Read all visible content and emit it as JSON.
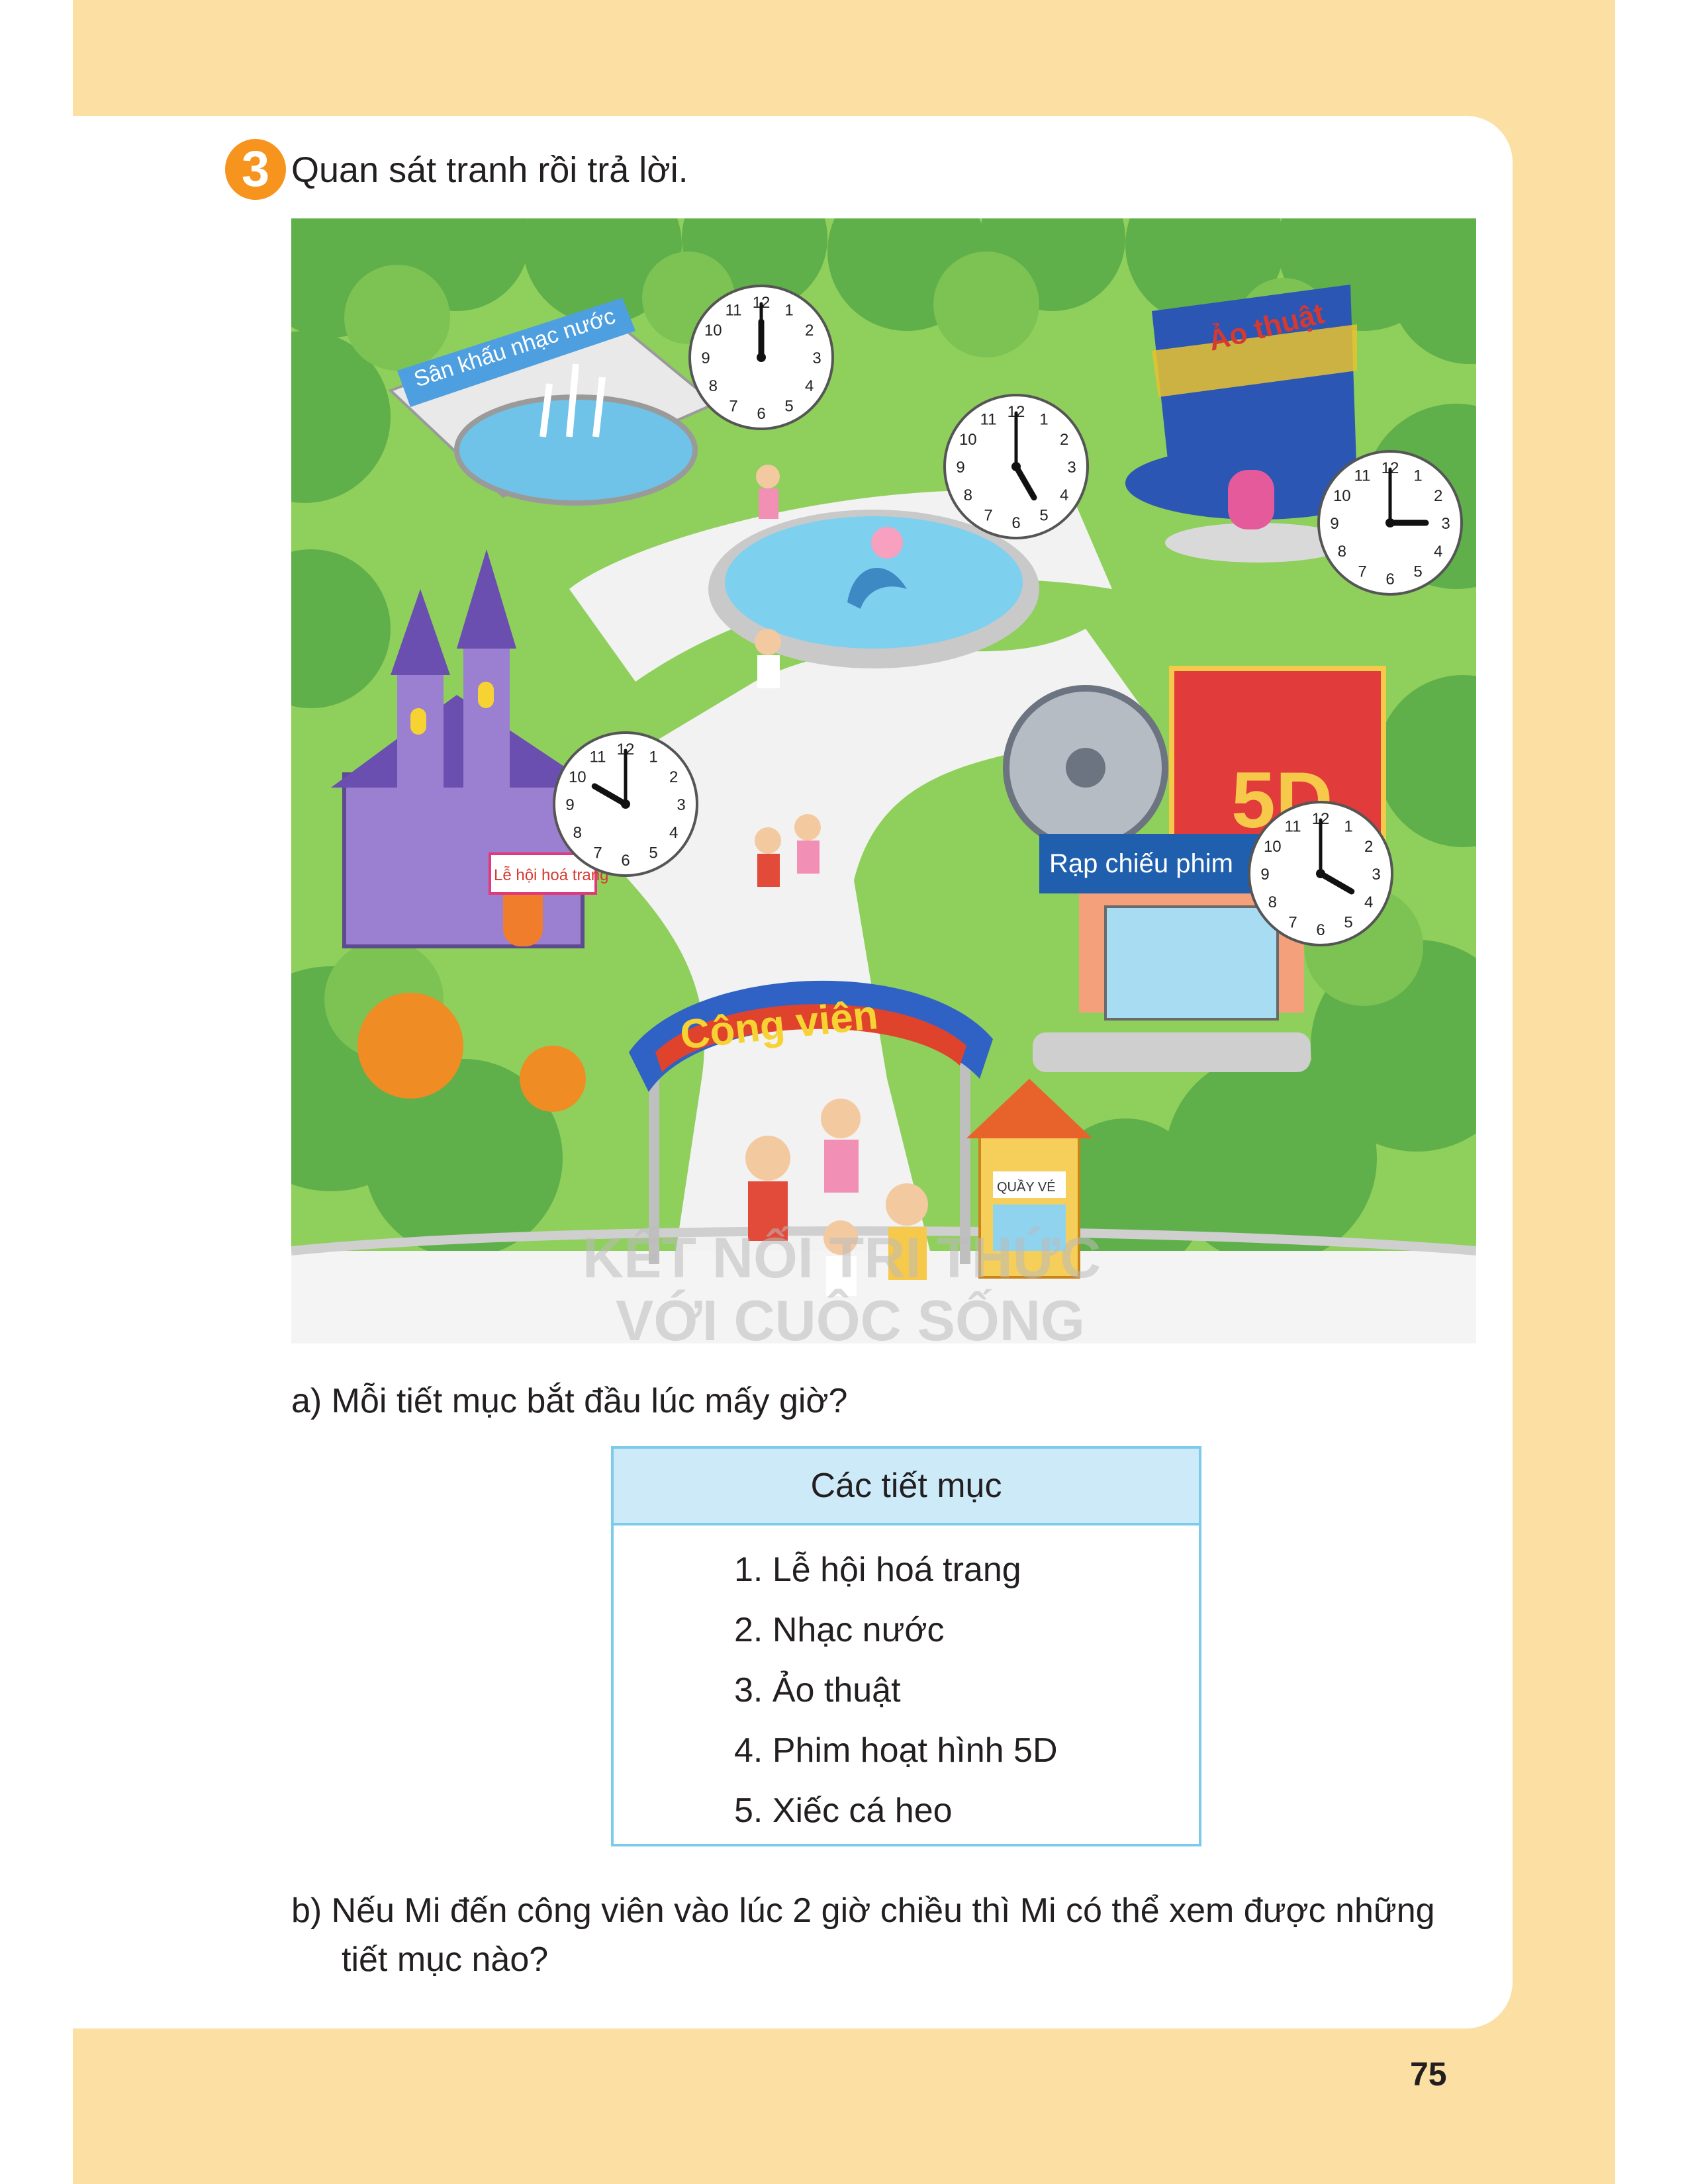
{
  "exercise": {
    "number": "3",
    "instruction": "Quan sát tranh rồi trả lời."
  },
  "illustration": {
    "signs": {
      "water_stage": "Sân khấu nhạc nước",
      "magic": "Ảo thuật",
      "festival": "Lễ hội hoá trang",
      "cinema": "Rạp chiếu phim",
      "cinema_5d": "5D",
      "park_gate": "Công viên",
      "ticket_booth": "QUẦY VÉ"
    },
    "watermark": [
      "KẾT NỐI TRI THỨC",
      "VỚI CUỘC SỐNG"
    ],
    "clocks": [
      {
        "name": "clock-water-stage",
        "hour": 12,
        "minute": 0
      },
      {
        "name": "clock-dolphin-show",
        "hour": 5,
        "minute": 0
      },
      {
        "name": "clock-magic-show",
        "hour": 3,
        "minute": 0
      },
      {
        "name": "clock-festival",
        "hour": 10,
        "minute": 0
      },
      {
        "name": "clock-cinema",
        "hour": 4,
        "minute": 0
      }
    ]
  },
  "question_a": "a) Mỗi tiết mục bắt đầu lúc mấy giờ?",
  "program_list": {
    "title": "Các tiết mục",
    "items": [
      "1. Lễ hội hoá trang",
      "2. Nhạc nước",
      "3. Ảo thuật",
      "4. Phim hoạt hình 5D",
      "5. Xiếc cá heo"
    ]
  },
  "question_b": "b) Nếu Mi đến công viên vào lúc 2 giờ chiều thì Mi có thể xem được những tiết mục nào?",
  "page_number": "75"
}
